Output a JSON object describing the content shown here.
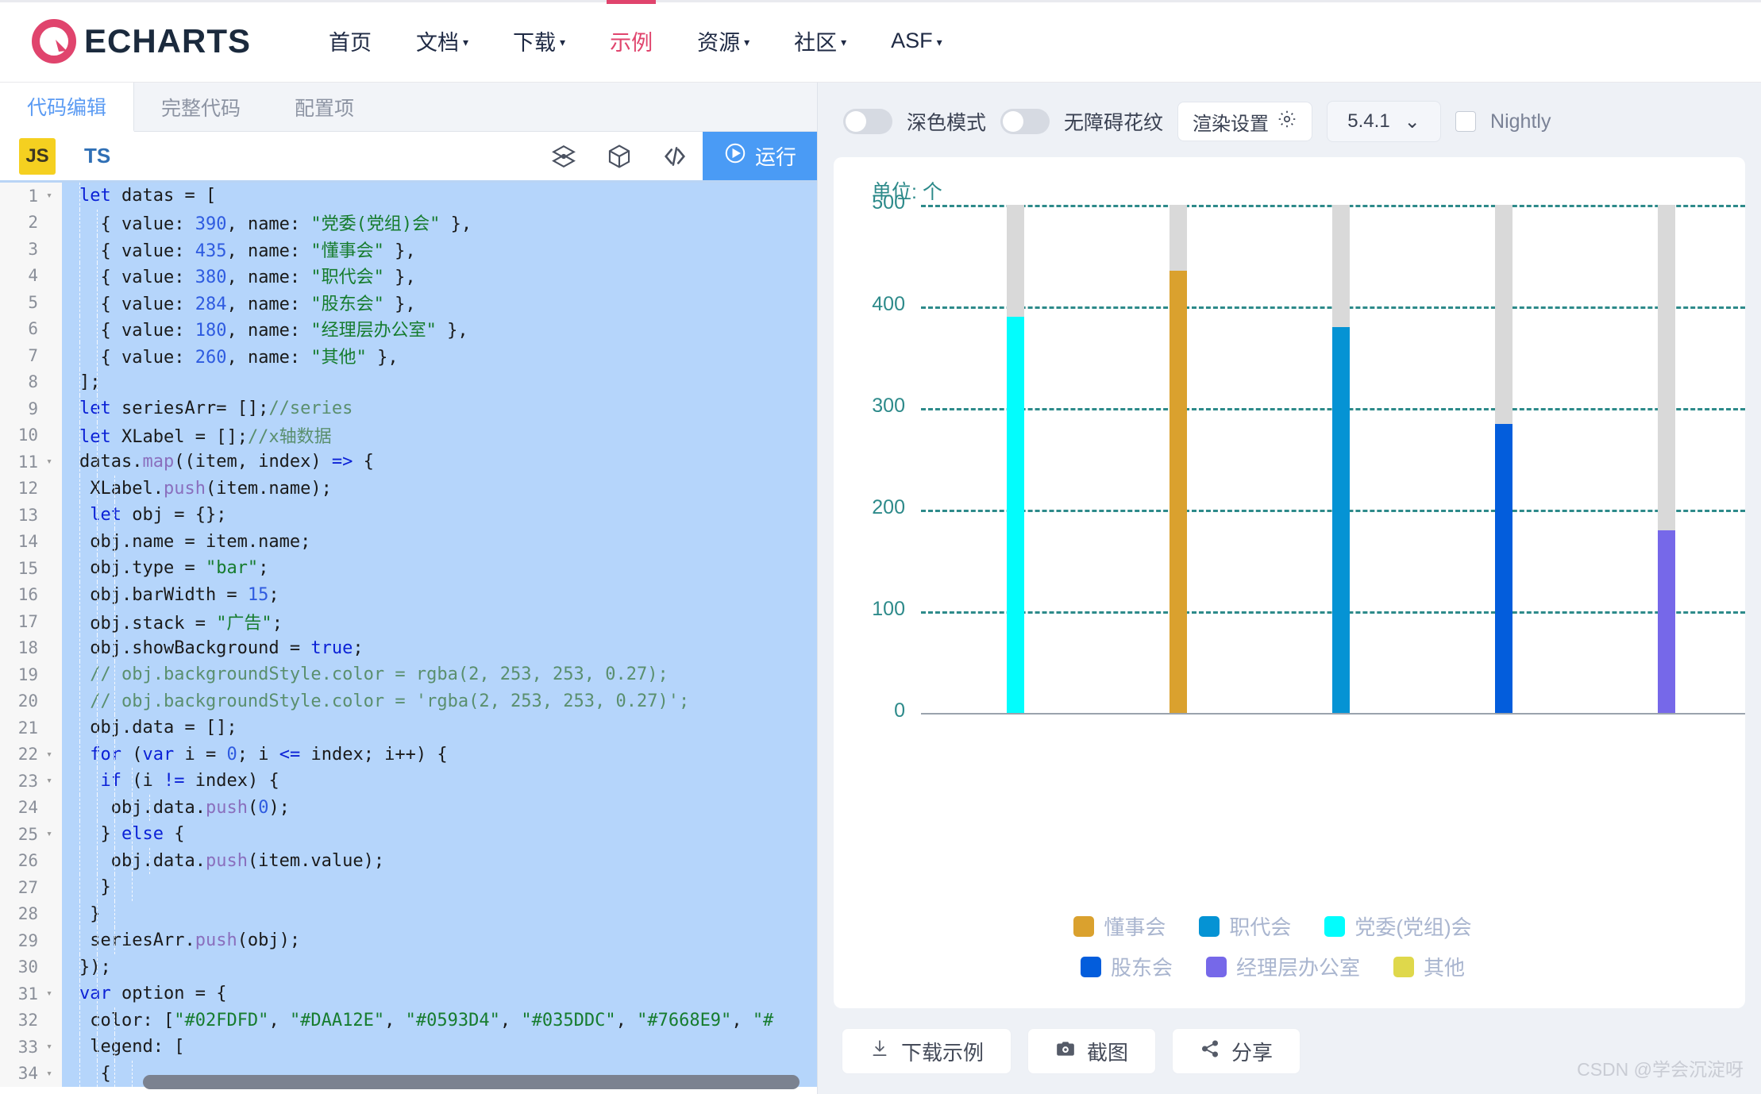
{
  "header": {
    "brand": "ECHARTS",
    "nav": [
      {
        "label": "首页",
        "caret": false,
        "active": false
      },
      {
        "label": "文档",
        "caret": true,
        "active": false
      },
      {
        "label": "下载",
        "caret": true,
        "active": false
      },
      {
        "label": "示例",
        "caret": false,
        "active": true
      },
      {
        "label": "资源",
        "caret": true,
        "active": false
      },
      {
        "label": "社区",
        "caret": true,
        "active": false
      },
      {
        "label": "ASF",
        "caret": true,
        "active": false
      }
    ],
    "caret_glyph": "▾",
    "accent_color": "#e0446d"
  },
  "editor": {
    "tabs": [
      {
        "label": "代码编辑",
        "active": true
      },
      {
        "label": "完整代码",
        "active": false
      },
      {
        "label": "配置项",
        "active": false
      }
    ],
    "lang_js": "JS",
    "lang_ts": "TS",
    "icons": [
      "layout-grid-icon",
      "cube-icon",
      "code-brackets-icon"
    ],
    "run_label": "运行",
    "run_icon": "play-circle-icon",
    "lines": [
      {
        "n": "1",
        "fold": true,
        "indent": 1,
        "html": "<span class=\"kw\">let</span> datas = ["
      },
      {
        "n": "2",
        "fold": false,
        "indent": 2,
        "html": "  { value: <span class=\"num\">390</span>, name: <span class=\"str\">\"党委(党组)会\"</span> },"
      },
      {
        "n": "3",
        "fold": false,
        "indent": 2,
        "html": "  { value: <span class=\"num\">435</span>, name: <span class=\"str\">\"懂事会\"</span> },"
      },
      {
        "n": "4",
        "fold": false,
        "indent": 2,
        "html": "  { value: <span class=\"num\">380</span>, name: <span class=\"str\">\"职代会\"</span> },"
      },
      {
        "n": "5",
        "fold": false,
        "indent": 2,
        "html": "  { value: <span class=\"num\">284</span>, name: <span class=\"str\">\"股东会\"</span> },"
      },
      {
        "n": "6",
        "fold": false,
        "indent": 2,
        "html": "  { value: <span class=\"num\">180</span>, name: <span class=\"str\">\"经理层办公室\"</span> },"
      },
      {
        "n": "7",
        "fold": false,
        "indent": 2,
        "html": "  { value: <span class=\"num\">260</span>, name: <span class=\"str\">\"其他\"</span> },"
      },
      {
        "n": "8",
        "fold": false,
        "indent": 2,
        "html": "];"
      },
      {
        "n": "9",
        "fold": false,
        "indent": 2,
        "html": "<span class=\"kw\">let</span> seriesArr= [];<span class=\"cmt\">//series</span>"
      },
      {
        "n": "10",
        "fold": false,
        "indent": 2,
        "html": "<span class=\"kw\">let</span> XLabel = [];<span class=\"cmt\">//x轴数据</span>"
      },
      {
        "n": "11",
        "fold": true,
        "indent": 2,
        "html": "datas.<span class=\"fn\">map</span>((item, index) <span class=\"op\">=&gt;</span> {"
      },
      {
        "n": "12",
        "fold": false,
        "indent": 3,
        "html": " XLabel.<span class=\"fn\">push</span>(item.name);"
      },
      {
        "n": "13",
        "fold": false,
        "indent": 3,
        "html": " <span class=\"kw\">let</span> obj = {};"
      },
      {
        "n": "14",
        "fold": false,
        "indent": 3,
        "html": " obj.name = item.name;"
      },
      {
        "n": "15",
        "fold": false,
        "indent": 3,
        "html": " obj.type = <span class=\"str\">\"bar\"</span>;"
      },
      {
        "n": "16",
        "fold": false,
        "indent": 3,
        "html": " obj.barWidth = <span class=\"num\">15</span>;"
      },
      {
        "n": "17",
        "fold": false,
        "indent": 3,
        "html": " obj.stack = <span class=\"str\">\"广告\"</span>;"
      },
      {
        "n": "18",
        "fold": false,
        "indent": 3,
        "html": " obj.showBackground = <span class=\"kw\">true</span>;"
      },
      {
        "n": "19",
        "fold": false,
        "indent": 3,
        "html": " <span class=\"cmt\">// obj.backgroundStyle.color = rgba(2, 253, 253, 0.27);</span>"
      },
      {
        "n": "20",
        "fold": false,
        "indent": 3,
        "html": " <span class=\"cmt\">// obj.backgroundStyle.color = 'rgba(2, 253, 253, 0.27)';</span>"
      },
      {
        "n": "21",
        "fold": false,
        "indent": 3,
        "html": " obj.data = [];"
      },
      {
        "n": "22",
        "fold": true,
        "indent": 3,
        "html": " <span class=\"kw\">for</span> (<span class=\"kw\">var</span> i = <span class=\"num\">0</span>; i <span class=\"op\">&lt;=</span> index; i++) {"
      },
      {
        "n": "23",
        "fold": true,
        "indent": 4,
        "html": "  <span class=\"kw\">if</span> (i <span class=\"op\">!=</span> index) {"
      },
      {
        "n": "24",
        "fold": false,
        "indent": 5,
        "html": "   obj.data.<span class=\"fn\">push</span>(<span class=\"num\">0</span>);"
      },
      {
        "n": "25",
        "fold": true,
        "indent": 4,
        "html": "  } <span class=\"kw\">else</span> {"
      },
      {
        "n": "26",
        "fold": false,
        "indent": 5,
        "html": "   obj.data.<span class=\"fn\">push</span>(item.value);"
      },
      {
        "n": "27",
        "fold": false,
        "indent": 4,
        "html": "  }"
      },
      {
        "n": "28",
        "fold": false,
        "indent": 3,
        "html": " }"
      },
      {
        "n": "29",
        "fold": false,
        "indent": 3,
        "html": " seriesArr.<span class=\"fn\">push</span>(obj);"
      },
      {
        "n": "30",
        "fold": false,
        "indent": 2,
        "html": "});"
      },
      {
        "n": "31",
        "fold": true,
        "indent": 2,
        "html": "<span class=\"kw\">var</span> option = {"
      },
      {
        "n": "32",
        "fold": false,
        "indent": 3,
        "html": " color: [<span class=\"str\">\"#02FDFD\"</span>, <span class=\"str\">\"#DAA12E\"</span>, <span class=\"str\">\"#0593D4\"</span>, <span class=\"str\">\"#035DDC\"</span>, <span class=\"str\">\"#7668E9\"</span>, <span class=\"str\">\"#</span>"
      },
      {
        "n": "33",
        "fold": true,
        "indent": 3,
        "html": " legend: ["
      },
      {
        "n": "34",
        "fold": true,
        "indent": 4,
        "html": "  {"
      }
    ]
  },
  "preview": {
    "dark_mode_label": "深色模式",
    "pattern_label": "无障碍花纹",
    "render_settings_label": "渲染设置",
    "render_settings_icon": "gear-icon",
    "version": "5.4.1",
    "version_caret": "⌄",
    "nightly_label": "Nightly",
    "actions": [
      {
        "label": "下载示例",
        "icon": "download-icon"
      },
      {
        "label": "截图",
        "icon": "camera-icon"
      },
      {
        "label": "分享",
        "icon": "share-icon"
      }
    ]
  },
  "watermark": "CSDN @学会沉淀呀",
  "chart_data": {
    "type": "bar",
    "title": "",
    "unit_label": "单位: 个",
    "categories": [
      "党委(党组)会",
      "懂事会",
      "职代会",
      "股东会",
      "经理层办公室",
      "其他"
    ],
    "values": [
      390,
      435,
      380,
      284,
      180,
      260
    ],
    "bar_colors": [
      "#02FDFD",
      "#DAA12E",
      "#0593D4",
      "#035DDC",
      "#7668E9",
      "#DFD84B"
    ],
    "background_bar_color": "#d9d9d9",
    "background_bar_value": 500,
    "xlabel": "",
    "ylabel": "",
    "ylim": [
      0,
      500
    ],
    "yticks": [
      500,
      400,
      300,
      200,
      100,
      0
    ],
    "grid": true,
    "grid_color": "#2d8a8a",
    "grid_style": "dashed",
    "axis_label_color": "#2d8a8a",
    "legend_position": "bottom",
    "visible_bars": [
      {
        "name": "党委(党组)会",
        "value": 390,
        "color": "#02FDFD"
      },
      {
        "name": "懂事会",
        "value": 435,
        "color": "#DAA12E"
      },
      {
        "name": "职代会",
        "value": 380,
        "color": "#0593D4"
      },
      {
        "name": "股东会",
        "value": 284,
        "color": "#035DDC"
      },
      {
        "name": "经理层办公室",
        "value": 180,
        "color": "#7668E9"
      }
    ],
    "legend_rows": [
      [
        {
          "label": "懂事会",
          "color": "#DAA12E"
        },
        {
          "label": "职代会",
          "color": "#0593D4"
        },
        {
          "label": "党委(党组)会",
          "color": "#02FDFD"
        }
      ],
      [
        {
          "label": "股东会",
          "color": "#035DDC"
        },
        {
          "label": "经理层办公室",
          "color": "#7668E9"
        },
        {
          "label": "其他",
          "color": "#DFD84B"
        }
      ]
    ]
  }
}
